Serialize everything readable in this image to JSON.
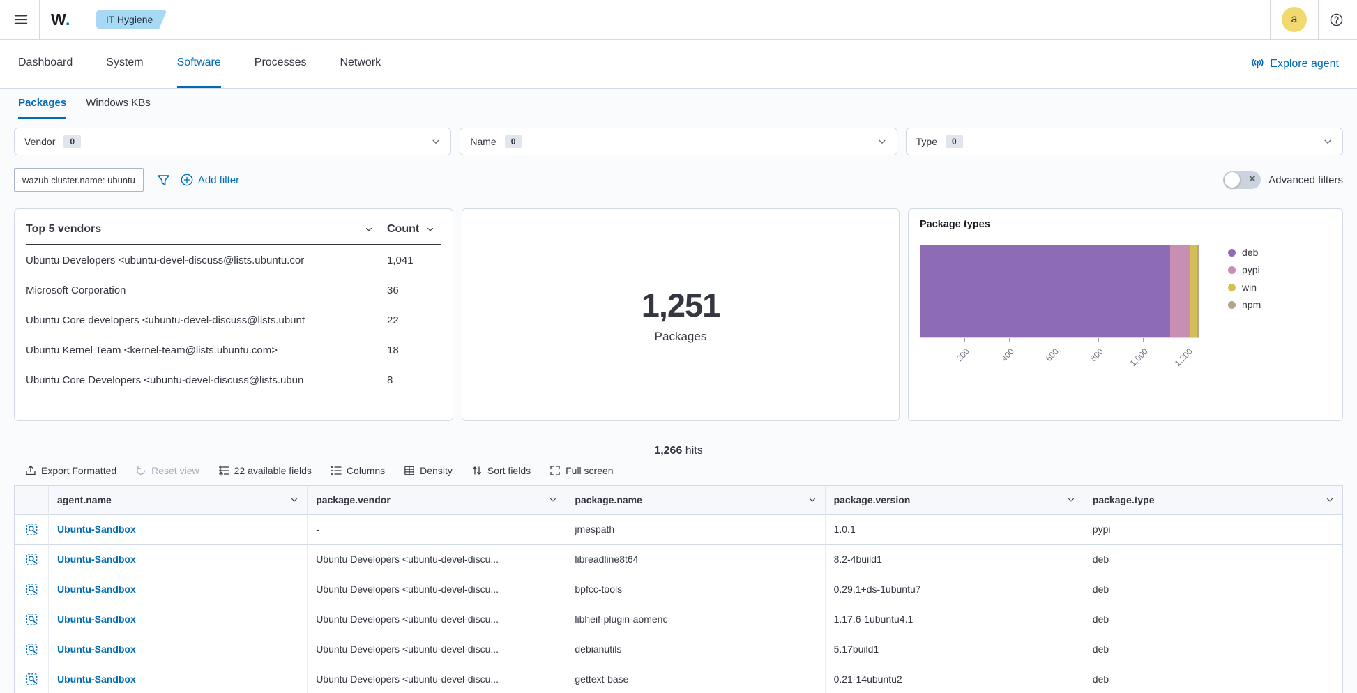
{
  "header": {
    "logo_text": "W",
    "logo_dot": ".",
    "breadcrumb": "IT Hygiene",
    "avatar_initial": "a"
  },
  "nav": {
    "tabs": [
      {
        "label": "Dashboard"
      },
      {
        "label": "System"
      },
      {
        "label": "Software"
      },
      {
        "label": "Processes"
      },
      {
        "label": "Network"
      }
    ],
    "active_tab": "Software",
    "explore_agent_label": "Explore agent"
  },
  "subnav": {
    "tabs": [
      {
        "label": "Packages"
      },
      {
        "label": "Windows KBs"
      }
    ],
    "active_tab": "Packages"
  },
  "filters": {
    "selects": [
      {
        "label": "Vendor",
        "count": "0"
      },
      {
        "label": "Name",
        "count": "0"
      },
      {
        "label": "Type",
        "count": "0"
      }
    ],
    "active_filter_pill": "wazuh.cluster.name: ubuntu",
    "add_filter_label": "Add filter",
    "advanced_filters_label": "Advanced filters"
  },
  "top_vendors": {
    "title": "Top 5 vendors",
    "count_header": "Count",
    "rows": [
      {
        "vendor": "Ubuntu Developers <ubuntu-devel-discuss@lists.ubuntu.cor",
        "count": "1,041"
      },
      {
        "vendor": "Microsoft Corporation",
        "count": "36"
      },
      {
        "vendor": "Ubuntu Core developers <ubuntu-devel-discuss@lists.ubunt",
        "count": "22"
      },
      {
        "vendor": "Ubuntu Kernel Team <kernel-team@lists.ubuntu.com>",
        "count": "18"
      },
      {
        "vendor": "Ubuntu Core Developers <ubuntu-devel-discuss@lists.ubun",
        "count": "8"
      }
    ]
  },
  "packages_metric": {
    "value": "1,251",
    "label": "Packages"
  },
  "chart_data": {
    "type": "bar",
    "orientation": "horizontal-stacked",
    "title": "Package types",
    "series": [
      {
        "name": "deb",
        "value": 1128,
        "color": "#8d6cb5"
      },
      {
        "name": "pypi",
        "value": 85,
        "color": "#c98fb2"
      },
      {
        "name": "win",
        "value": 36,
        "color": "#d3bf56"
      },
      {
        "name": "npm",
        "value": 2,
        "color": "#b2a58b"
      }
    ],
    "total": 1251,
    "xlim": [
      0,
      1251
    ],
    "x_ticks": [
      "200",
      "400",
      "600",
      "800",
      "1,000",
      "1,200"
    ],
    "x_tick_values": [
      200,
      400,
      600,
      800,
      1000,
      1200
    ],
    "legend_position": "right",
    "grid": false
  },
  "results": {
    "hits_value": "1,266",
    "hits_label": "hits",
    "toolbar": {
      "export": "Export Formatted",
      "reset": "Reset view",
      "fields": "22 available fields",
      "columns": "Columns",
      "density": "Density",
      "sort": "Sort fields",
      "fullscreen": "Full screen"
    },
    "table": {
      "columns": [
        "agent.name",
        "package.vendor",
        "package.name",
        "package.version",
        "package.type"
      ],
      "rows": [
        {
          "agent": "Ubuntu-Sandbox",
          "vendor": "-",
          "name": "jmespath",
          "version": "1.0.1",
          "type": "pypi"
        },
        {
          "agent": "Ubuntu-Sandbox",
          "vendor": "Ubuntu Developers <ubuntu-devel-discu...",
          "name": "libreadline8t64",
          "version": "8.2-4build1",
          "type": "deb"
        },
        {
          "agent": "Ubuntu-Sandbox",
          "vendor": "Ubuntu Developers <ubuntu-devel-discu...",
          "name": "bpfcc-tools",
          "version": "0.29.1+ds-1ubuntu7",
          "type": "deb"
        },
        {
          "agent": "Ubuntu-Sandbox",
          "vendor": "Ubuntu Developers <ubuntu-devel-discu...",
          "name": "libheif-plugin-aomenc",
          "version": "1.17.6-1ubuntu4.1",
          "type": "deb"
        },
        {
          "agent": "Ubuntu-Sandbox",
          "vendor": "Ubuntu Developers <ubuntu-devel-discu...",
          "name": "debianutils",
          "version": "5.17build1",
          "type": "deb"
        },
        {
          "agent": "Ubuntu-Sandbox",
          "vendor": "Ubuntu Developers <ubuntu-devel-discu...",
          "name": "gettext-base",
          "version": "0.21-14ubuntu2",
          "type": "deb"
        }
      ]
    }
  },
  "colors": {
    "primary": "#006bb4",
    "text": "#343741",
    "subdued": "#69707d",
    "border": "#d3dae6",
    "badge_bg": "#a7d9f4",
    "avatar_bg": "#f1d86f"
  }
}
